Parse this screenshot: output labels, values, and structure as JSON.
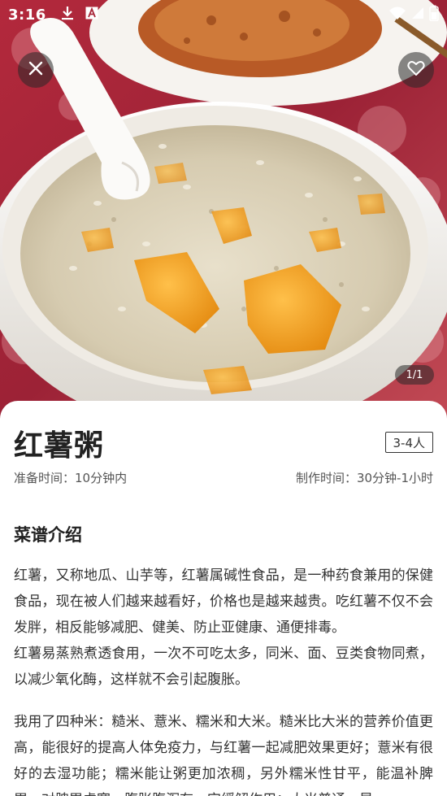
{
  "status_bar": {
    "time": "3:16",
    "icons": [
      "download-icon",
      "text-a-icon",
      "wifi-icon",
      "signal-icon",
      "battery-icon"
    ]
  },
  "gallery": {
    "counter": "1/1",
    "close_icon": "close-icon",
    "favorite_icon": "heart-outline-icon"
  },
  "recipe": {
    "title": "红薯粥",
    "servings": "3-4人",
    "prep_time": "准备时间：10分钟内",
    "cook_time": "制作时间：30分钟-1小时",
    "intro_heading": "菜谱介绍",
    "intro_paragraphs": [
      "红薯，又称地瓜、山芋等，红薯属碱性食品，是一种药食兼用的保健食品，现在被人们越来越看好，价格也是越来越贵。吃红薯不仅不会发胖，相反能够减肥、健美、防止亚健康、通便排毒。",
      "红薯易蒸熟煮透食用，一次不可吃太多，同米、面、豆类食物同煮，以减少氧化酶，这样就不会引起腹胀。",
      "我用了四种米：糙米、薏米、糯米和大米。糙米比大米的营养价值更高，能很好的提高人体免疫力，与红薯一起减肥效果更好；薏米有很好的去湿功能；糯米能让粥更加浓稠，另外糯米性甘平，能温补脾胃，对脾胃虚寒、腹胀腹泻有一定缓解作用；大米普通，是"
    ]
  },
  "colors": {
    "tablecloth": "#a8283a",
    "bowl": "#f4f1ec",
    "porridge": "#dcd3bd",
    "sweet_potato": "#f0a020",
    "overlay": "#282828"
  }
}
